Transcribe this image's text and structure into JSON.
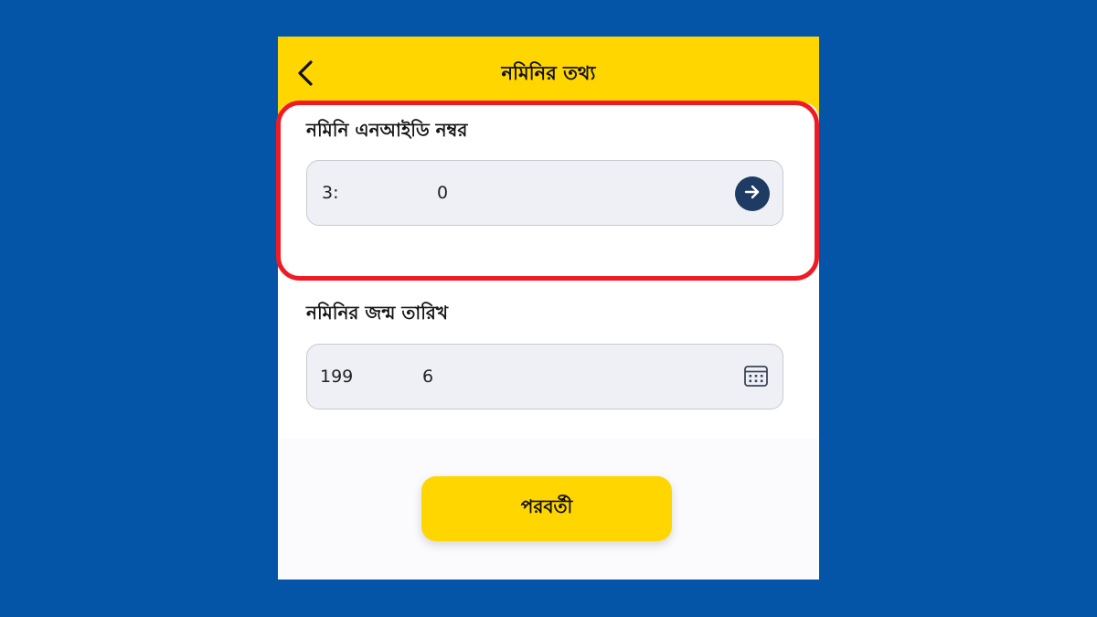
{
  "header": {
    "title": "নমিনির তথ্য",
    "back_icon": "chevron-left-icon",
    "background": "#ffd600"
  },
  "nid_field": {
    "label": "নমিনি এনআইডি নম্বর",
    "value_start": "3:",
    "value_end": "0",
    "submit_icon": "arrow-right-icon"
  },
  "dob_field": {
    "label": "নমিনির  জন্ম তারিখ",
    "value_start": "199",
    "value_end": "6",
    "calendar_icon": "calendar-icon"
  },
  "footer": {
    "next_label": "পরবর্তী"
  },
  "colors": {
    "page_background": "#0455a8",
    "accent_yellow": "#ffd600",
    "highlight_red": "#ee1b24",
    "arrow_button": "#1d3b63"
  }
}
